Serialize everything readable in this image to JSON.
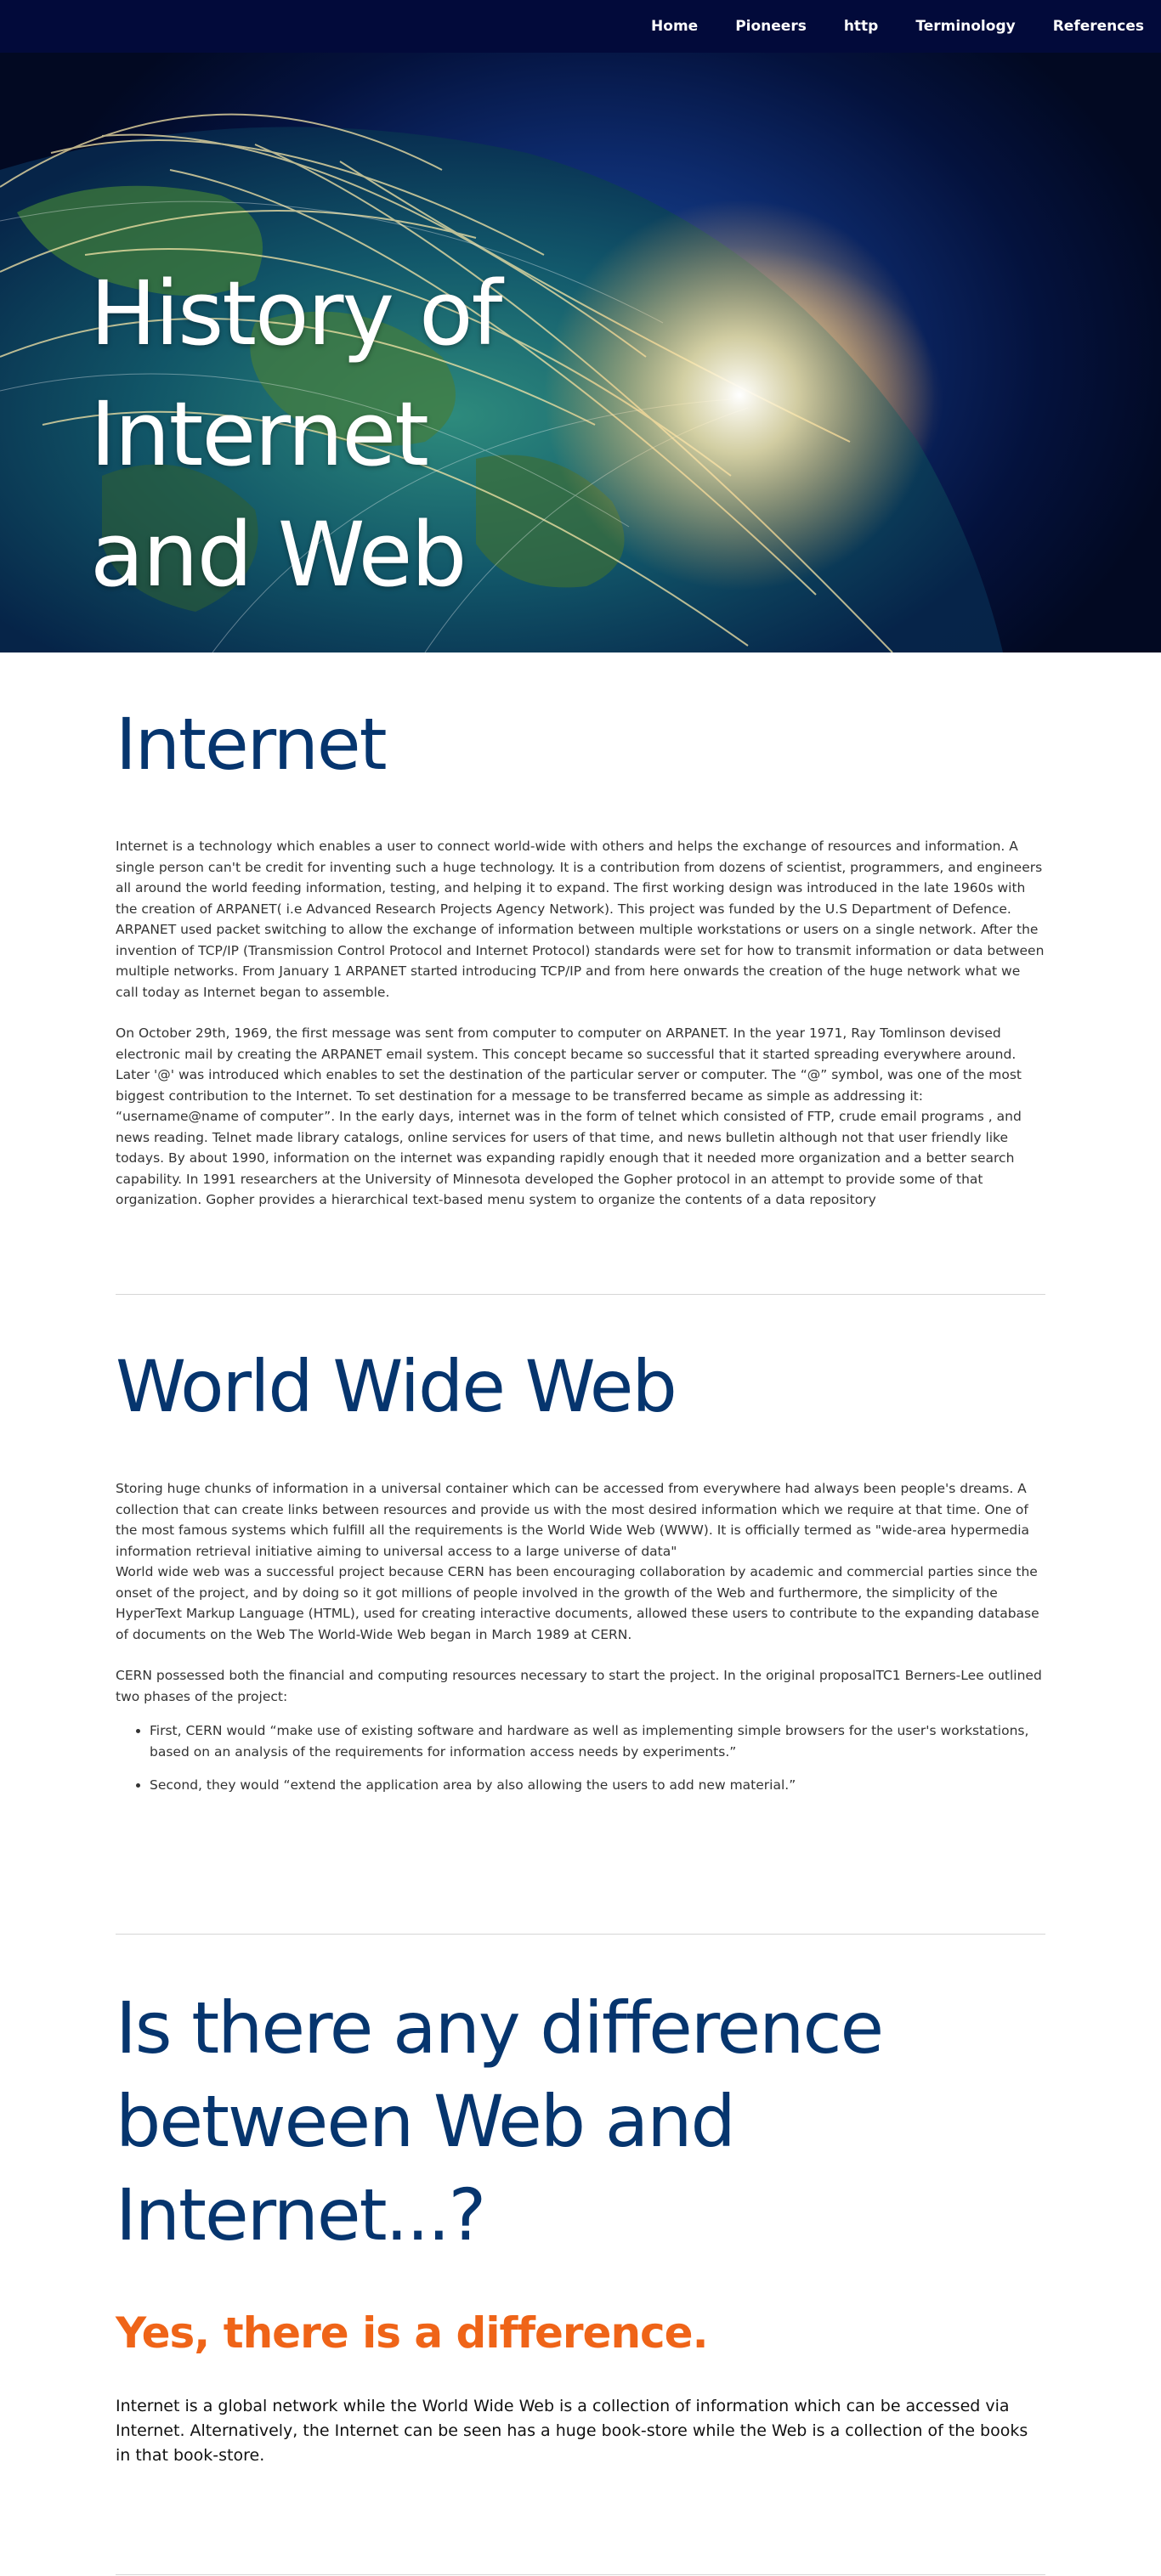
{
  "nav": {
    "items": [
      {
        "label": "Home"
      },
      {
        "label": "Pioneers"
      },
      {
        "label": "http"
      },
      {
        "label": "Terminology"
      },
      {
        "label": "References"
      }
    ]
  },
  "hero": {
    "title_line1": "History of Internet",
    "title_line2": "and Web"
  },
  "internet": {
    "title": "Internet",
    "p1": "Internet is a technology which enables a user to connect world-wide with others and helps the exchange of resources and information. A single person can't be credit for inventing such a huge technology. It is a contribution from dozens of scientist, programmers, and engineers all around the world feeding information, testing, and helping it to expand. The first working design was introduced in the late 1960s with the creation of ARPANET( i.e Advanced Research Projects Agency Network). This project was funded by the U.S Department of Defence. ARPANET used packet switching to allow the exchange of information between multiple workstations or users on a single network. After the invention of TCP/IP (Transmission Control Protocol and Internet Protocol) standards were set for how to transmit information or data between multiple networks. From January 1 ARPANET started introducing TCP/IP and from here onwards the creation of the huge network what we call today as Internet began to assemble.",
    "p2": "On October 29th, 1969, the first message was sent from computer to computer on ARPANET. In the year 1971, Ray Tomlinson devised electronic mail by creating the ARPANET email system. This concept became so successful that it started spreading everywhere around. Later '@' was introduced which enables to set the destination of the particular server or computer. The “@” symbol, was one of the most biggest contribution to the Internet. To set destination for a message to be transferred became as simple as addressing it: “username@name of computer”. In the early days, internet was in the form of telnet which consisted of FTP, crude email programs , and news reading. Telnet made library catalogs, online services for users of that time, and news bulletin although not that user friendly like todays. By about 1990, information on the internet was expanding rapidly enough that it needed more organization and a better search capability. In 1991 researchers at the University of Minnesota developed the Gopher protocol in an attempt to provide some of that organization. Gopher provides a hierarchical text-based menu system to organize the contents of a data repository"
  },
  "www": {
    "title": "World Wide Web",
    "p1a": "Storing huge chunks of information in a universal container which can be accessed from everywhere had always been people's dreams. A collection that can create links between resources and provide us with the most desired information which we require at that time. One of the most famous systems which fulfill all the requirements is the World Wide Web (WWW). It is officially termed as \"wide-area hypermedia information retrieval initiative aiming to universal access to a large universe of data\"",
    "p1b": "World wide web was a successful project because CERN has been encouraging collaboration by academic and commercial parties since the onset of the project, and by doing so it got millions of people involved in the growth of the Web and furthermore, the simplicity of the HyperText Markup Language (HTML), used for creating interactive documents, allowed these users to contribute to the expanding database of documents on the Web The World-Wide Web began in March 1989 at CERN.",
    "p2": "CERN possessed both the financial and computing resources necessary to start the project. In the original proposalTC1 Berners-Lee outlined two phases of the project:",
    "bullets": [
      "First, CERN would “make use of existing software and hardware as well as implementing simple browsers for the user's workstations, based on an analysis of the requirements for information access needs by experiments.”",
      "Second, they would “extend the application area by also allowing the users to add new material.”"
    ]
  },
  "difference": {
    "title_line1": "Is there any difference",
    "title_line2": "between Web and",
    "title_line3": "Internet...?",
    "subtitle": "Yes, there is a difference.",
    "text": "Internet is a global network while the World Wide Web is a collection of information which can be accessed via Internet. Alternatively, the Internet can be seen has a huge book-store while the Web is a collection of the books in that book-store."
  },
  "colors": {
    "nav_bg": "#020a3a",
    "heading_blue": "#06356e",
    "accent_orange": "#ef6418"
  }
}
